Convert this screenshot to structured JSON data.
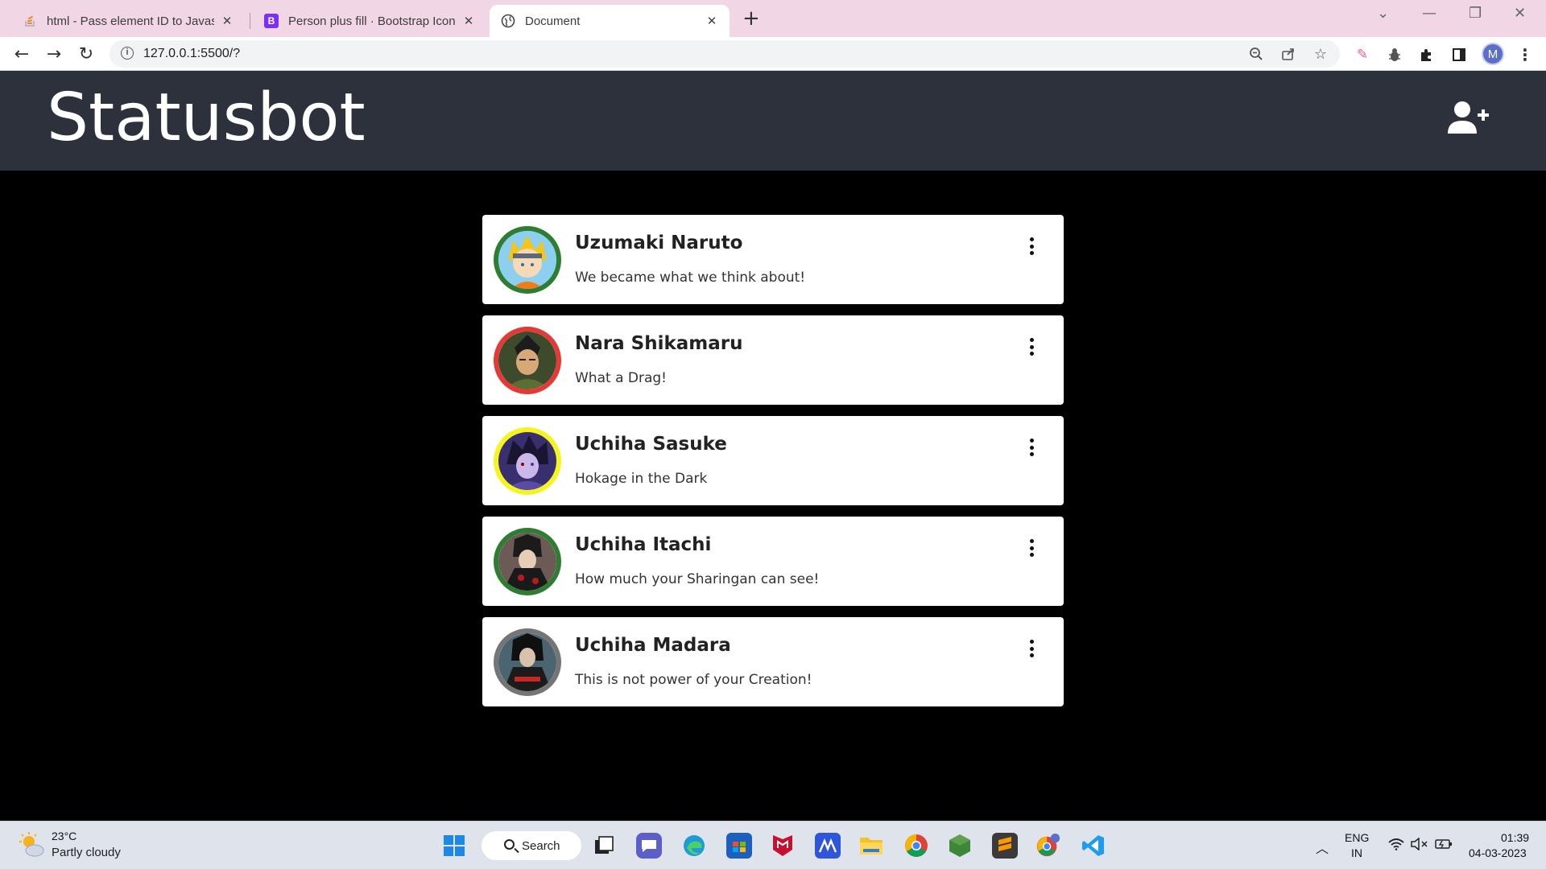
{
  "browser": {
    "tabs": [
      {
        "title": "html - Pass element ID to Javascr",
        "icon": "stackoverflow-icon",
        "active": false
      },
      {
        "title": "Person plus fill · Bootstrap Icons",
        "icon": "bootstrap-icon",
        "active": false
      },
      {
        "title": "Document",
        "icon": "globe-icon",
        "active": true
      }
    ],
    "url": "127.0.0.1:5500/?",
    "profile_initial": "M"
  },
  "app": {
    "brand": "Statusbot",
    "accent_navbar": "#2d313b"
  },
  "contacts": [
    {
      "name": "Uzumaki Naruto",
      "status": "We became what we think about!",
      "ring_color": "#2e7d32"
    },
    {
      "name": "Nara Shikamaru",
      "status": "What a Drag!",
      "ring_color": "#e53935"
    },
    {
      "name": "Uchiha Sasuke",
      "status": "Hokage in the Dark",
      "ring_color": "#f5f51e"
    },
    {
      "name": "Uchiha Itachi",
      "status": "How much your Sharingan can see!",
      "ring_color": "#2e7d32"
    },
    {
      "name": "Uchiha Madara",
      "status": "This is not power of your Creation!",
      "ring_color": "#757575"
    }
  ],
  "taskbar": {
    "temperature": "23°C",
    "weather": "Partly cloudy",
    "search_label": "Search",
    "lang_top": "ENG",
    "lang_bottom": "IN",
    "time": "01:39",
    "date": "04-03-2023"
  }
}
